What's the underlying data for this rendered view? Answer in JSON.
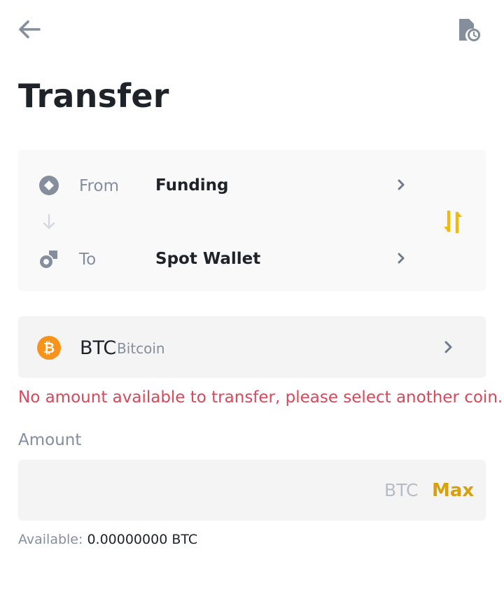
{
  "header": {
    "back_icon": "arrow-left-icon",
    "history_icon": "document-clock-icon",
    "title": "Transfer"
  },
  "transfer": {
    "from": {
      "label": "From",
      "value": "Funding",
      "icon": "funding-wallet-icon"
    },
    "to": {
      "label": "To",
      "value": "Spot Wallet",
      "icon": "spot-wallet-icon"
    },
    "swap_icon": "swap-vertical-icon",
    "direction_icon": "arrow-down-icon"
  },
  "coin": {
    "symbol": "BTC",
    "name": "Bitcoin",
    "icon": "bitcoin-icon",
    "error": "No amount available to transfer, please select another coin."
  },
  "amount": {
    "label": "Amount",
    "value": "",
    "placeholder": "",
    "unit": "BTC",
    "max_label": "Max",
    "available_label": "Available:",
    "available_value": "0.00000000 BTC"
  },
  "colors": {
    "accent": "#f0b90b",
    "max": "#d7a10d",
    "error": "#d9475a",
    "bitcoin": "#f7931a",
    "text_primary": "#1e2329",
    "text_secondary": "#848e9c"
  }
}
